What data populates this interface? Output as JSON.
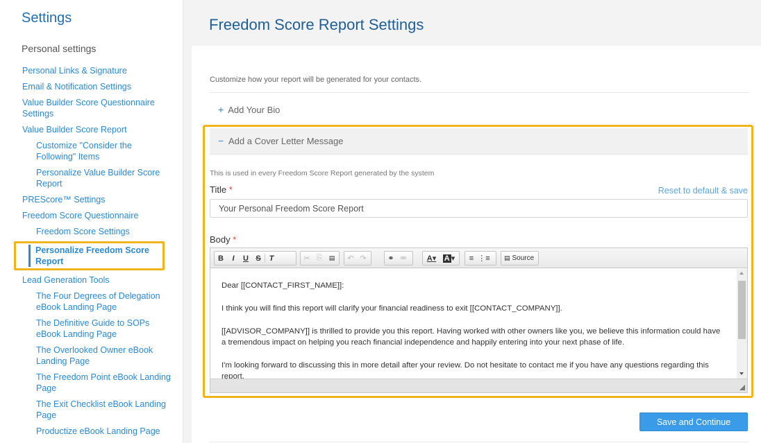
{
  "sidebar": {
    "title": "Settings",
    "personal_heading": "Personal settings",
    "items": [
      {
        "label": "Personal Links & Signature"
      },
      {
        "label": "Email & Notification Settings"
      },
      {
        "label": "Value Builder Score Questionnaire Settings"
      },
      {
        "label": "Value Builder Score Report"
      },
      {
        "label": "Customize \"Consider the Following\" Items"
      },
      {
        "label": "Personalize Value Builder Score Report"
      },
      {
        "label": "PREScore™ Settings"
      },
      {
        "label": "Freedom Score Questionnaire"
      },
      {
        "label": "Freedom Score Settings"
      },
      {
        "label": "Personalize Freedom Score Report"
      },
      {
        "label": "Lead Generation Tools"
      },
      {
        "label": "The Four Degrees of Delegation eBook Landing Page"
      },
      {
        "label": "The Definitive Guide to SOPs eBook Landing Page"
      },
      {
        "label": "The Overlooked Owner eBook Landing Page"
      },
      {
        "label": "The Freedom Point eBook Landing Page"
      },
      {
        "label": "The Exit Checklist eBook Landing Page"
      },
      {
        "label": "Productize eBook Landing Page"
      }
    ]
  },
  "main": {
    "page_title": "Freedom Score Report Settings",
    "intro": "Customize how your report will be generated for your contacts.",
    "add_bio": {
      "icon": "plus-icon",
      "label": "Add Your Bio"
    },
    "cover_letter": {
      "icon": "minus-icon",
      "label": "Add a Cover Letter Message",
      "note": "This is used in every Freedom Score Report generated by the system",
      "title_label": "Title",
      "required_mark": "*",
      "reset_link": "Reset to default & save",
      "title_value": "Your Personal Freedom Score Report",
      "body_label": "Body",
      "toolbar": {
        "bold": "B",
        "italic": "I",
        "underline": "U",
        "strike": "S",
        "clear": "T",
        "cut": "✂",
        "copy": "⎘",
        "paste": "📋",
        "undo": "↶",
        "redo": "↷",
        "link": "⚭",
        "unlink": "⚮",
        "text_color": "A",
        "bg_color": "A",
        "ol": "⅓",
        "ul": "☰",
        "source": "Source"
      },
      "body_paragraphs": [
        "Dear [[CONTACT_FIRST_NAME]]:",
        "I think you will find this report will clarify your financial readiness to exit [[CONTACT_COMPANY]].",
        "[[ADVISOR_COMPANY]] is thrilled to provide you this report. Having worked with other owners like you, we believe this information could have a tremendous impact on helping you reach financial independence and happily entering into your next phase of life.",
        "I'm looking forward to discussing this in more detail after your review. Do not hesitate to contact me if you have any questions regarding this report."
      ]
    },
    "save_button": "Save and Continue"
  },
  "colors": {
    "accent": "#2a8ad4",
    "highlight": "#f1b51c",
    "button": "#3a9be8"
  }
}
